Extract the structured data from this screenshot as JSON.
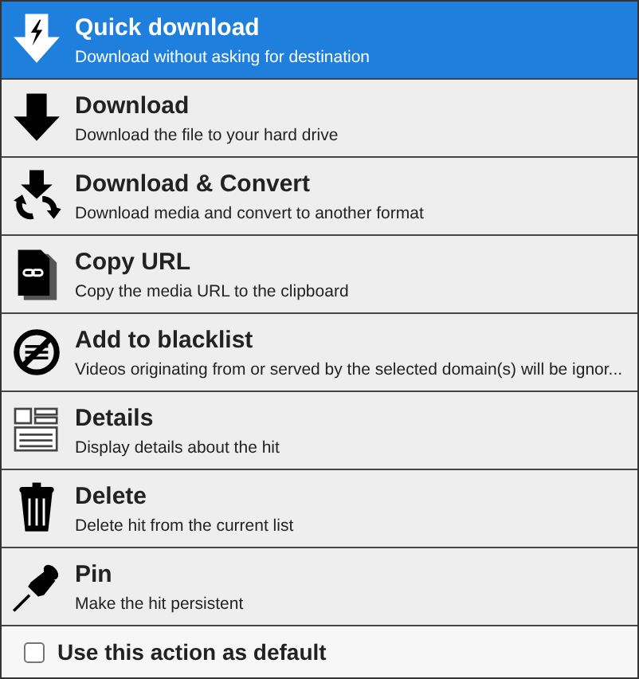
{
  "actions": [
    {
      "kind": "quick-download",
      "title": "Quick download",
      "description": "Download without asking for destination",
      "selected": true
    },
    {
      "kind": "download",
      "title": "Download",
      "description": "Download the file to your hard drive",
      "selected": false
    },
    {
      "kind": "convert",
      "title": "Download & Convert",
      "description": "Download media and convert to another format",
      "selected": false
    },
    {
      "kind": "copy-url",
      "title": "Copy URL",
      "description": "Copy the media URL to the clipboard",
      "selected": false
    },
    {
      "kind": "blacklist",
      "title": "Add to blacklist",
      "description": "Videos originating from or served by the selected domain(s) will be ignor...",
      "selected": false
    },
    {
      "kind": "details",
      "title": "Details",
      "description": "Display details about the hit",
      "selected": false
    },
    {
      "kind": "delete",
      "title": "Delete",
      "description": "Delete hit from the current list",
      "selected": false
    },
    {
      "kind": "pin",
      "title": "Pin",
      "description": "Make the hit persistent",
      "selected": false
    }
  ],
  "default_option": {
    "label": "Use this action as default",
    "checked": false
  }
}
